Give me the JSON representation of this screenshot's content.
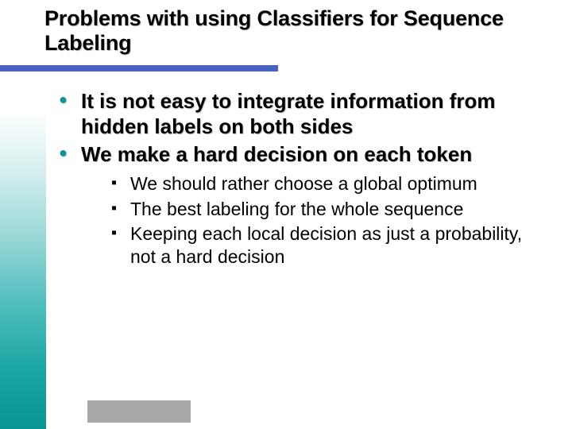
{
  "title": "Problems with using Classifiers for Sequence Labeling",
  "bullets": [
    {
      "text": "It is not easy to integrate information from hidden labels on both sides"
    },
    {
      "text": "We make a hard decision on each token",
      "sub": [
        "We should rather choose a global optimum",
        "The best labeling for the whole sequence",
        "Keeping each local decision as just a probability, not a hard decision"
      ]
    }
  ]
}
